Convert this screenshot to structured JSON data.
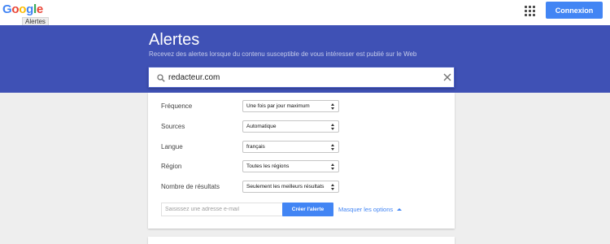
{
  "header": {
    "logo_letters": [
      {
        "char": "G",
        "color": "#4285f4"
      },
      {
        "char": "o",
        "color": "#ea4335"
      },
      {
        "char": "o",
        "color": "#fbbc05"
      },
      {
        "char": "g",
        "color": "#4285f4"
      },
      {
        "char": "l",
        "color": "#34a853"
      },
      {
        "char": "e",
        "color": "#ea4335"
      }
    ],
    "tooltip": "Alertes",
    "apps_icon": "apps-grid-icon",
    "signin_label": "Connexion",
    "signin_color": "#4285f4"
  },
  "hero": {
    "title": "Alertes",
    "subtitle": "Recevez des alertes lorsque du contenu susceptible de vous intéresser est publié sur le Web",
    "background": "#3f51b5"
  },
  "search": {
    "value": "redacteur.com",
    "icon": "search-icon",
    "clear_icon": "close-icon"
  },
  "options": [
    {
      "label": "Fréquence",
      "value": "Une fois par jour maximum"
    },
    {
      "label": "Sources",
      "value": "Automatique"
    },
    {
      "label": "Langue",
      "value": "français"
    },
    {
      "label": "Région",
      "value": "Toutes les régions"
    },
    {
      "label": "Nombre de résultats",
      "value": "Seulement les meilleurs résultats"
    }
  ],
  "form": {
    "email_placeholder": "Saisissez une adresse e-mail",
    "create_label": "Créer l'alerte",
    "create_color": "#4285f4",
    "options_link": "Masquer les options",
    "link_color": "#4285f4"
  }
}
